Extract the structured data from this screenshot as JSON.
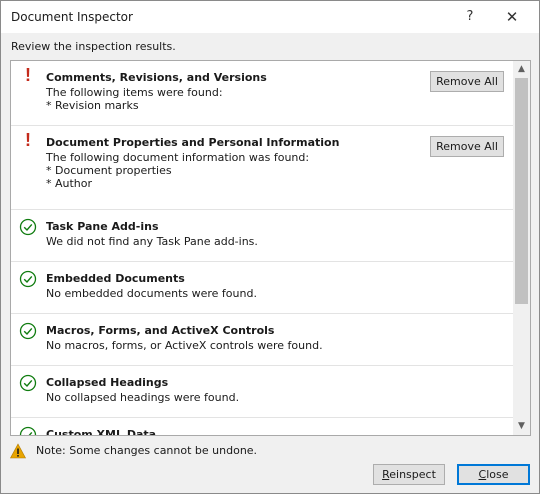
{
  "window": {
    "title": "Document Inspector",
    "help_label": "?",
    "close_label": "✕"
  },
  "subtitle": "Review the inspection results.",
  "results": [
    {
      "status": "issue",
      "title": "Comments, Revisions, and Versions",
      "lines": [
        "The following items were found:",
        "* Revision marks"
      ],
      "action": "Remove All"
    },
    {
      "status": "issue",
      "title": "Document Properties and Personal Information",
      "lines": [
        "The following document information was found:",
        "* Document properties",
        "* Author"
      ],
      "action": "Remove All"
    },
    {
      "status": "ok",
      "title": "Task Pane Add-ins",
      "lines": [
        "We did not find any Task Pane add-ins."
      ]
    },
    {
      "status": "ok",
      "title": "Embedded Documents",
      "lines": [
        "No embedded documents were found."
      ]
    },
    {
      "status": "ok",
      "title": "Macros, Forms, and ActiveX Controls",
      "lines": [
        "No macros, forms, or ActiveX controls were found."
      ]
    },
    {
      "status": "ok",
      "title": "Collapsed Headings",
      "lines": [
        "No collapsed headings were found."
      ]
    },
    {
      "status": "ok",
      "title": "Custom XML Data",
      "lines": []
    }
  ],
  "issue_mark": "!",
  "scroll": {
    "up_arrow": "▲",
    "down_arrow": "▼",
    "position_fraction": 0.0
  },
  "note": "Note: Some changes cannot be undone.",
  "buttons": {
    "reinspect_first": "R",
    "reinspect_rest": "einspect",
    "close_first": "C",
    "close_rest": "lose"
  },
  "colors": {
    "issue": "#c42b1c",
    "ok": "#107c10",
    "warning": "#e8a400",
    "focus": "#0078d7"
  }
}
